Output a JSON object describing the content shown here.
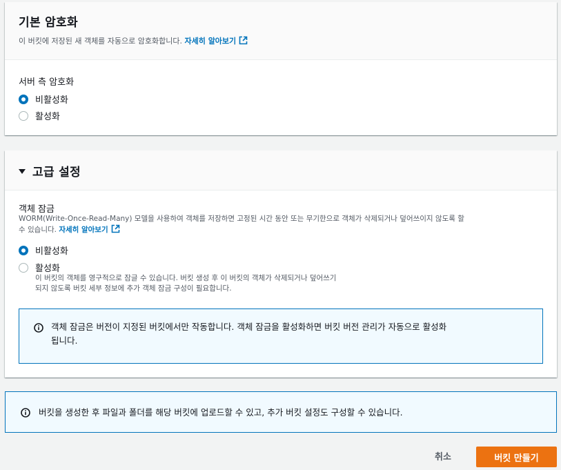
{
  "encryption": {
    "title": "기본 암호화",
    "description": "이 버킷에 저장된 새 객체를 자동으로 암호화합니다.",
    "learn_more": "자세히 알아보기",
    "server_side_label": "서버 측 암호화",
    "options": [
      "비활성화",
      "활성화"
    ],
    "selected": "비활성화"
  },
  "advanced": {
    "title": "고급 설정",
    "object_lock": {
      "label": "객체 잠금",
      "description": "WORM(Write-Once-Read-Many) 모델을 사용하여 객체를 저장하면 고정된 시간 동안 또는 무기한으로 객체가 삭제되거나 덮어쓰이지 않도록 할",
      "description_line2": "수 있습니다.",
      "learn_more": "자세히 알아보기",
      "options": [
        "비활성화",
        "활성화"
      ],
      "selected": "비활성화",
      "enable_help_line1": "이 버킷의 객체를 영구적으로 잠글 수 있습니다. 버킷 생성 후 이 버킷의 객체가 삭제되거나 덮어쓰기",
      "enable_help_line2": "되지 않도록 버킷 세부 정보에 추가 객체 잠금 구성이 필요합니다.",
      "info_line1": "객체 잠금은 버전이 지정된 버킷에서만 작동합니다. 객체 잠금을 활성화하면 버킷 버전 관리가 자동으로 활성화",
      "info_line2": "됩니다."
    }
  },
  "bottom_info": "버킷을 생성한 후 파일과 폴더를 해당 버킷에 업로드할 수 있고, 추가 버킷 설정도 구성할 수 있습니다.",
  "actions": {
    "cancel": "취소",
    "create": "버킷 만들기"
  },
  "colors": {
    "link": "#0073bb",
    "primary_button": "#ec7211",
    "info_border": "#0073bb",
    "info_bg": "#f1faff"
  },
  "icons": [
    "external-link-icon",
    "info-icon",
    "caret-down-icon"
  ]
}
